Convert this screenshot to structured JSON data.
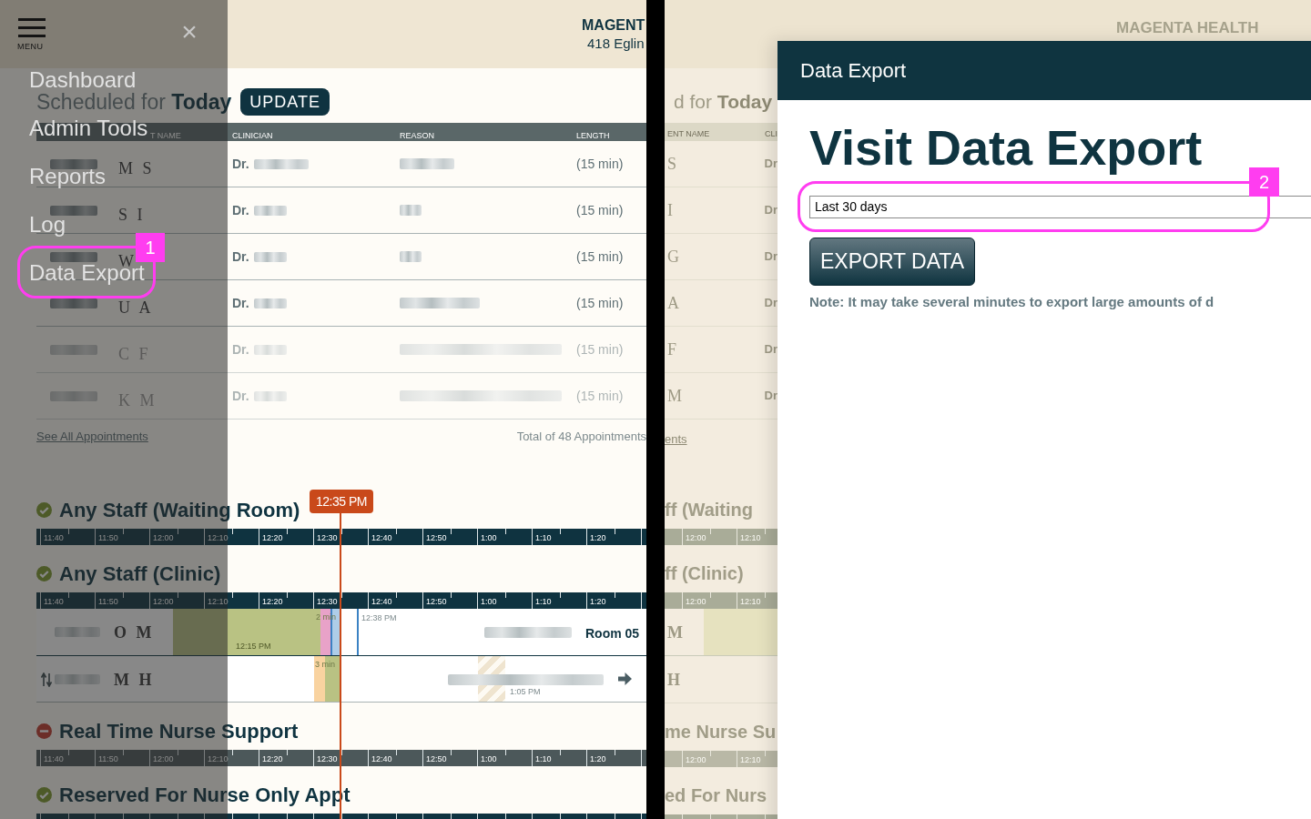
{
  "left_screen": {
    "header": {
      "name": "MAGENT",
      "address": "418 Eglin"
    },
    "schedule": {
      "title": "Scheduled for **Today**",
      "update_button": "UPDATE",
      "columns": [
        "T NAME",
        "CLINICIAN",
        "REASON",
        "LENGTH"
      ],
      "rows": [
        {
          "patient": "M S",
          "clinician": "Dr.",
          "length": "(15 min)",
          "faded": false
        },
        {
          "patient": "S I",
          "clinician": "Dr.",
          "length": "(15 min)",
          "faded": false
        },
        {
          "patient": "W",
          "clinician": "Dr.",
          "length": "(15 min)",
          "faded": false
        },
        {
          "patient": "U A",
          "clinician": "Dr.",
          "length": "(15 min)",
          "faded": false
        },
        {
          "patient": "C F",
          "clinician": "Dr.",
          "length": "(15 min)",
          "faded": true
        },
        {
          "patient": "K M",
          "clinician": "Dr.",
          "length": "(15 min)",
          "faded": true
        }
      ]
    },
    "see_all_link": "See All Appointments",
    "total": "Total of 48 Appointments",
    "now_marker": "12:35 PM",
    "sections": [
      {
        "kind": "available",
        "title": "Any Staff (Waiting Room)",
        "ticks": [
          "11:40",
          "11:50",
          "12:00",
          "12:10",
          "12:20",
          "12:30",
          "12:40",
          "12:50",
          "1:00",
          "1:10",
          "1:20"
        ]
      },
      {
        "kind": "available",
        "title": "Any Staff (Clinic)",
        "ticks": [
          "11:40",
          "11:50",
          "12:00",
          "12:10",
          "12:20",
          "12:30",
          "12:40",
          "12:50",
          "1:00",
          "1:10",
          "1:20"
        ],
        "rows": [
          {
            "kind": "in_room",
            "patient": "O M",
            "start_time": "12:15 PM",
            "gap": "2 min",
            "arrival_time": "12:38 PM",
            "room": "Room 05"
          },
          {
            "kind": "upcoming",
            "patient": "M H",
            "gap": "3 min",
            "end_time": "1:05 PM"
          }
        ]
      },
      {
        "kind": "unavailable",
        "title": "Real Time Nurse Support",
        "ticks": [
          "11:40",
          "11:50",
          "12:00",
          "12:10",
          "12:20",
          "12:30",
          "12:40",
          "12:50",
          "1:00",
          "1:10",
          "1:20"
        ]
      },
      {
        "kind": "available",
        "title": "Reserved For Nurse Only Appt"
      }
    ],
    "menu": {
      "label": "MENU",
      "close": "×",
      "items": [
        "Dashboard",
        "Admin Tools",
        "Reports",
        "Log",
        "Data Export"
      ]
    },
    "callout": {
      "number": "1"
    }
  },
  "right_screen": {
    "background": {
      "brand": "MAGENTA HEALTH",
      "title": "d for **Today**",
      "columns": [
        "ENT NAME",
        "CLI"
      ],
      "rows": [
        {
          "patient": "S",
          "clinician": "Dr"
        },
        {
          "patient": "I",
          "clinician": "Dr"
        },
        {
          "patient": "G",
          "clinician": "Dr"
        },
        {
          "patient": "A",
          "clinician": "Dr"
        },
        {
          "patient": "F",
          "clinician": "Dr"
        },
        {
          "patient": "M",
          "clinician": "Dr"
        }
      ],
      "see_all_link": "ents",
      "sections": [
        {
          "kind": "available",
          "title": "ff (Waiting",
          "ticks": [
            "12:00",
            "12:10"
          ]
        },
        {
          "kind": "available",
          "title": "ff (Clinic)",
          "ticks": [
            "12:00",
            "12:10"
          ],
          "rows": [
            {
              "kind": "in_room",
              "patient": "M"
            },
            {
              "kind": "upcoming",
              "patient": "H"
            }
          ]
        },
        {
          "kind": "unavailable",
          "title": "me Nurse Su",
          "ticks": [
            "12:00",
            "12:10"
          ]
        },
        {
          "kind": "available",
          "title": "ed For Nurs"
        }
      ]
    },
    "dialog": {
      "title": "Data Export",
      "heading": "Visit Data Export",
      "range": "Last 30 days",
      "button": "EXPORT DATA",
      "note": "Note: It may take several minutes to export large amounts of d"
    },
    "callout": {
      "number": "2"
    }
  }
}
